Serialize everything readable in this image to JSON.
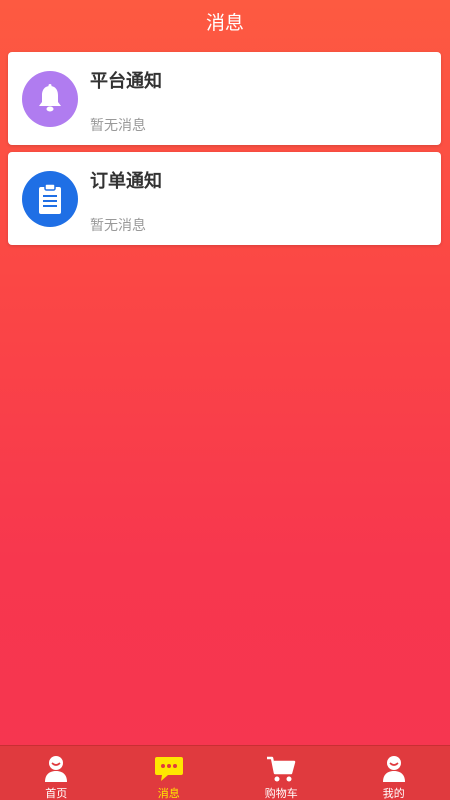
{
  "header": {
    "title": "消息"
  },
  "notifications": [
    {
      "title": "平台通知",
      "subtitle": "暂无消息",
      "icon": "bell-icon",
      "icon_bg": "#b07cf0"
    },
    {
      "title": "订单通知",
      "subtitle": "暂无消息",
      "icon": "clipboard-icon",
      "icon_bg": "#1f6fe5"
    }
  ],
  "tabbar": {
    "items": [
      {
        "label": "首页",
        "icon": "home-person-icon",
        "active": false
      },
      {
        "label": "消息",
        "icon": "chat-bubble-icon",
        "active": true
      },
      {
        "label": "购物车",
        "icon": "cart-icon",
        "active": false
      },
      {
        "label": "我的",
        "icon": "user-icon",
        "active": false
      }
    ],
    "active_color": "#ffe600"
  }
}
